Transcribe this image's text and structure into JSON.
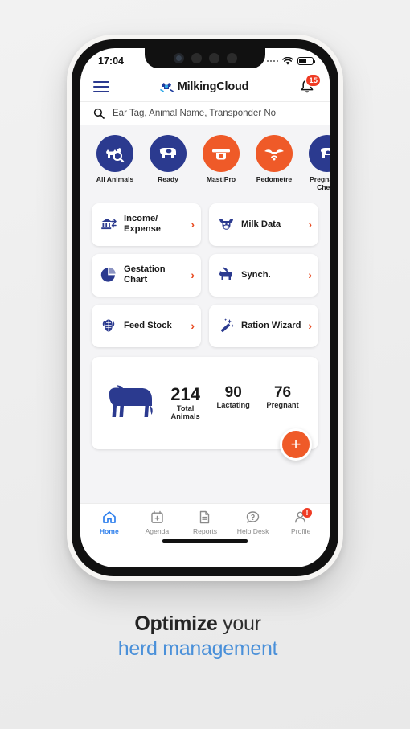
{
  "status_bar": {
    "time": "17:04"
  },
  "app_header": {
    "menu_icon": "hamburger-menu-icon",
    "brand_name": "MilkingCloud",
    "logo_icon": "milkingcloud-logo-icon",
    "bell_icon": "notification-bell-icon",
    "notification_count": "15"
  },
  "search": {
    "placeholder": "Ear Tag, Animal Name, Transponder No",
    "icon": "search-icon"
  },
  "categories": [
    {
      "label": "All Animals",
      "icon": "cow-search-icon",
      "color": "#2b3a8f"
    },
    {
      "label": "Ready",
      "icon": "cow-ready-icon",
      "color": "#2b3a8f"
    },
    {
      "label": "MastiPro",
      "icon": "milk-filter-icon",
      "color": "#ef5a28"
    },
    {
      "label": "Pedometre",
      "icon": "pedometer-horns-icon",
      "color": "#ef5a28"
    },
    {
      "label": "Pregnancy\nCheck",
      "icon": "pregnancy-check-icon",
      "color": "#2b3a8f"
    }
  ],
  "menu_cards": [
    {
      "label": "Income/\nExpense",
      "icon": "bank-transfer-icon"
    },
    {
      "label": "Milk Data",
      "icon": "cow-head-icon"
    },
    {
      "label": "Gestation\nChart",
      "icon": "pie-chart-icon"
    },
    {
      "label": "Synch.",
      "icon": "cow-syringe-icon"
    },
    {
      "label": "Feed Stock",
      "icon": "corn-icon"
    },
    {
      "label": "Ration Wizard",
      "icon": "magic-wand-icon"
    }
  ],
  "stats": {
    "animal_icon": "cow-silhouette-icon",
    "items": [
      {
        "value": "214",
        "caption": "Total\nAnimals"
      },
      {
        "value": "90",
        "caption": "Lactating"
      },
      {
        "value": "76",
        "caption": "Pregnant"
      }
    ],
    "fab_label": "+"
  },
  "bottom_nav": [
    {
      "label": "Home",
      "icon": "home-icon",
      "active": true
    },
    {
      "label": "Agenda",
      "icon": "calendar-plus-icon",
      "active": false
    },
    {
      "label": "Reports",
      "icon": "document-icon",
      "active": false
    },
    {
      "label": "Help Desk",
      "icon": "question-chat-icon",
      "active": false
    },
    {
      "label": "Profile",
      "icon": "user-icon",
      "active": false,
      "alert": "!"
    }
  ],
  "tagline": {
    "line1_bold": "Optimize",
    "line1_rest": " your",
    "line2": "herd management"
  },
  "colors": {
    "brand_navy": "#2b3a8f",
    "brand_orange": "#ef5a28",
    "accent_red": "#ef3b24",
    "tagline_blue": "#4a90d9"
  }
}
